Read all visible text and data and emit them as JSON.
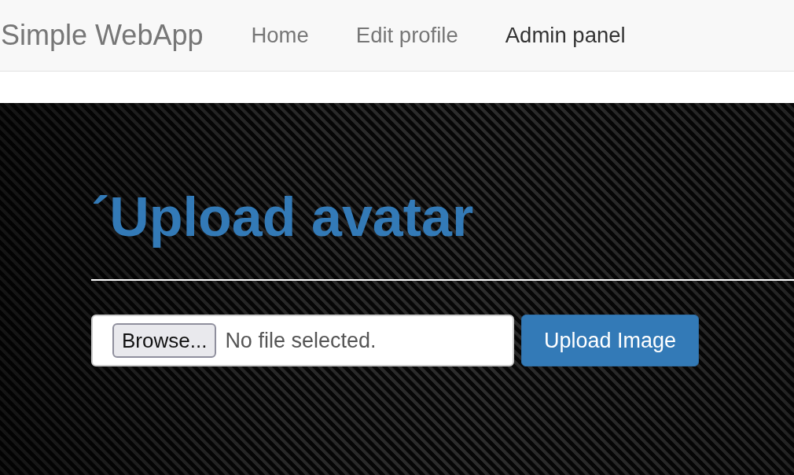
{
  "navbar": {
    "brand": "Simple WebApp",
    "items": [
      {
        "label": "Home",
        "selected": false
      },
      {
        "label": "Edit profile",
        "selected": false
      },
      {
        "label": "Admin panel",
        "selected": true
      }
    ]
  },
  "upload_form": {
    "title": "´Upload avatar",
    "file_input": {
      "button": "Browse...",
      "status": "No file selected."
    },
    "submit_button": "Upload Image"
  }
}
